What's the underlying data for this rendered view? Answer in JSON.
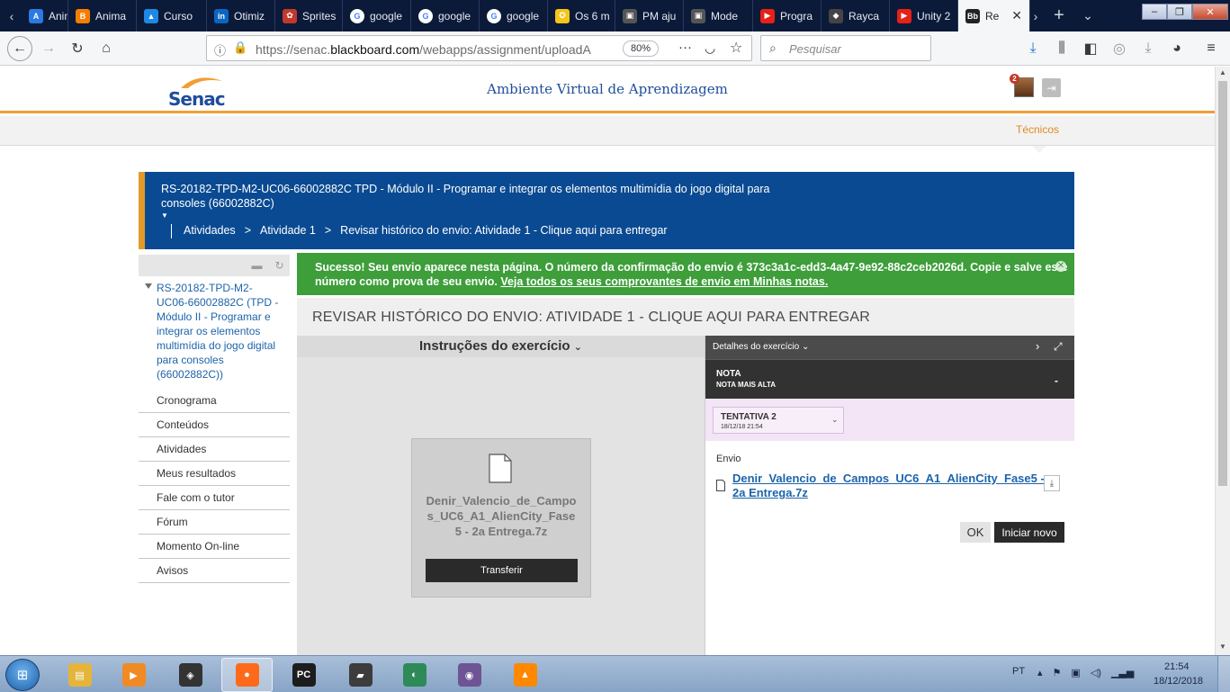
{
  "browser": {
    "tabs": [
      {
        "label": "Anima",
        "color": "#2a7ae2",
        "glyph": "A"
      },
      {
        "label": "Anima",
        "color": "#f57d00",
        "glyph": "B"
      },
      {
        "label": "Curso",
        "color": "#1e88e5",
        "glyph": "▲"
      },
      {
        "label": "Otimiz",
        "color": "#0a66c2",
        "glyph": "in"
      },
      {
        "label": "Sprites",
        "color": "#c0392b",
        "glyph": "✿"
      },
      {
        "label": "google",
        "color": "#ffffff",
        "glyph": "G"
      },
      {
        "label": "google",
        "color": "#ffffff",
        "glyph": "G"
      },
      {
        "label": "google",
        "color": "#ffffff",
        "glyph": "G"
      },
      {
        "label": "Os 6 m",
        "color": "#f5c518",
        "glyph": "✪"
      },
      {
        "label": "PM aju",
        "color": "#555555",
        "glyph": "▣"
      },
      {
        "label": "Mode",
        "color": "#555555",
        "glyph": "▣"
      },
      {
        "label": "Progra",
        "color": "#e62117",
        "glyph": "▶"
      },
      {
        "label": "Rayca",
        "color": "#444444",
        "glyph": "◆"
      },
      {
        "label": "Unity 2",
        "color": "#e62117",
        "glyph": "▶"
      },
      {
        "label": "Re",
        "color": "#222222",
        "glyph": "Bb"
      }
    ],
    "url": "https://senac.blackboard.com/webapps/assignment/uploadA",
    "url_domain": "blackboard.com",
    "zoom": "80%",
    "search_placeholder": "Pesquisar"
  },
  "site": {
    "logo_text": "Senac",
    "title": "Ambiente Virtual de Aprendizagem",
    "notif_count": "2",
    "nav_tab": "Técnicos"
  },
  "course": {
    "title": "RS-20182-TPD-M2-UC06-66002882C TPD - Módulo II - Programar e integrar os elementos multimídia do jogo digital para consoles (66002882C)",
    "breadcrumb": [
      "Atividades",
      "Atividade 1",
      "Revisar histórico do envio: Atividade 1 - Clique aqui para entregar"
    ]
  },
  "leftnav": {
    "course_link": "RS-20182-TPD-M2-UC06-66002882C (TPD - Módulo II - Programar e integrar os elementos multimídia do jogo digital para consoles (66002882C))",
    "items": [
      "Cronograma",
      "Conteúdos",
      "Atividades",
      "Meus resultados",
      "Fale com o tutor",
      "Fórum",
      "Momento On-line",
      "Avisos"
    ]
  },
  "success": {
    "message": "Sucesso! Seu envio aparece nesta página. O número da confirmação do envio é 373c3a1c-edd3-4a47-9e92-88c2ceb2026d. Copie e salve este número como prova de seu envio.",
    "link": "Veja todos os seus comprovantes de envio em Minhas notas."
  },
  "main": {
    "heading": "REVISAR HISTÓRICO DO ENVIO: ATIVIDADE 1 - CLIQUE AQUI PARA ENTREGAR",
    "instructions_label": "Instruções do exercício",
    "file_name": "Denir_Valencio_de_Campos_UC6_A1_AlienCity_Fase5 - 2a Entrega.7z",
    "download_label": "Transferir"
  },
  "details": {
    "header": "Detalhes do exercício",
    "grade_label": "NOTA",
    "grade_sublabel": "NOTA MAIS ALTA",
    "grade_value": "-",
    "attempt_label": "TENTATIVA 2",
    "attempt_date": "18/12/18 21:54",
    "envio_label": "Envio",
    "file_link": "Denir_Valencio_de_Campos_UC6_A1_AlienCity_Fase5 - 2a Entrega.7z",
    "ok_label": "OK",
    "new_label": "Iniciar novo"
  },
  "taskbar": {
    "apps": [
      {
        "name": "explorer",
        "color": "#e4b53a",
        "glyph": "▤"
      },
      {
        "name": "media-player",
        "color": "#f08a24",
        "glyph": "▶"
      },
      {
        "name": "unity",
        "color": "#333333",
        "glyph": "◈"
      },
      {
        "name": "firefox",
        "color": "#ff6a1a",
        "glyph": "●"
      },
      {
        "name": "pycharm",
        "color": "#1d1d1d",
        "glyph": "PC"
      },
      {
        "name": "scanner",
        "color": "#3c3c3c",
        "glyph": "▰"
      },
      {
        "name": "earth",
        "color": "#2e8b57",
        "glyph": "◐"
      },
      {
        "name": "github",
        "color": "#6e5494",
        "glyph": "◉"
      },
      {
        "name": "vlc",
        "color": "#ff8800",
        "glyph": "▲"
      }
    ],
    "lang": "PT",
    "time": "21:54",
    "date": "18/12/2018"
  }
}
